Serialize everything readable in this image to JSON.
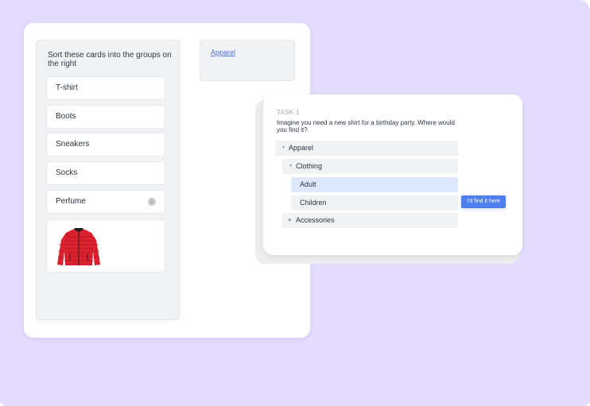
{
  "source_panel": {
    "instructions": "Sort these cards into the groups on the right",
    "cards": [
      {
        "label": "T-shirt"
      },
      {
        "label": "Boots"
      },
      {
        "label": "Sneakers"
      },
      {
        "label": "Socks"
      },
      {
        "label": "Perfume",
        "icon": "info-icon",
        "icon_glyph": "i"
      }
    ],
    "image_card": {
      "icon": "red-jacket-image"
    }
  },
  "groups": [
    {
      "label": "Apparel"
    }
  ],
  "task": {
    "label": "TASK 1",
    "question": "Imagine you need a new shirt for a birthday party. Where would you find it?",
    "tree": [
      {
        "label": "Apparel",
        "caret": "▼",
        "level": 0
      },
      {
        "label": "Clothing",
        "caret": "▼",
        "level": 1
      },
      {
        "label": "Adult",
        "caret": "",
        "level": 2,
        "highlighted": true
      },
      {
        "label": "Children",
        "caret": "",
        "level": 2
      },
      {
        "label": "Accessories",
        "caret": "▶",
        "level": 1
      }
    ],
    "action_button": "I'd find it here"
  },
  "colors": {
    "background": "#e4dcfe",
    "accent": "#4e7ef0",
    "highlight": "#dfe9fd",
    "link": "#4a72d8"
  }
}
